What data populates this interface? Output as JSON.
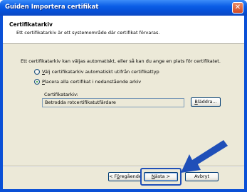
{
  "window": {
    "title": "Guiden Importera certifikat",
    "close_icon": "close-icon"
  },
  "header": {
    "title": "Certifikatarkiv",
    "description": "Ett certifikatarkiv är ett systemområde där certifikat förvaras."
  },
  "body": {
    "intro": "Ett certifikatarkiv kan väljas automatiskt, eller så kan du ange en plats för certifikatet.",
    "options": [
      {
        "accel": "V",
        "rest": "älj certifikatarkiv automatiskt utifrån certifikattyp",
        "selected": false
      },
      {
        "accel": "P",
        "rest": "lacera alla certifikat i nedanstående arkiv",
        "selected": true
      }
    ],
    "store_label": "Certifikatarkiv:",
    "store_value": "Betrodda rotcertifikatutfärdare",
    "browse_accel": "B",
    "browse_rest": "läddra..."
  },
  "footer": {
    "back_prefix": "< F",
    "back_accel": "ö",
    "back_rest": "regående",
    "next_accel": "N",
    "next_rest": "ästa >",
    "cancel": "Avbryt"
  },
  "annotation": {
    "arrow_color": "#1f4fb8",
    "arrow_icon": "pointer-arrow-icon"
  }
}
